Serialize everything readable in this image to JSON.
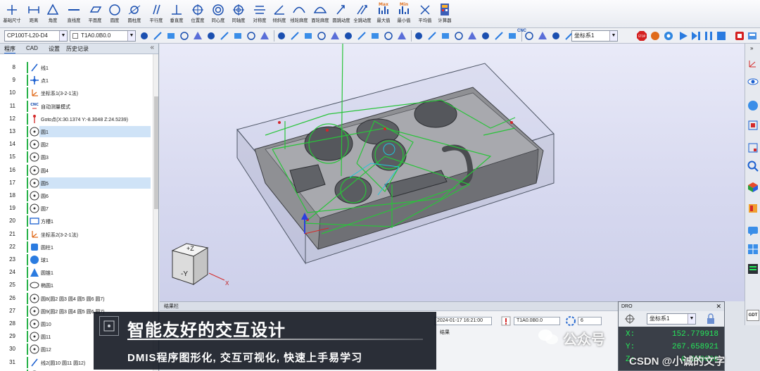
{
  "ribbon": {
    "buttons": [
      {
        "label": "基础尺寸",
        "icon": "basic-dimension-icon"
      },
      {
        "label": "距离",
        "icon": "distance-icon"
      },
      {
        "label": "角度",
        "icon": "angle-icon"
      },
      {
        "label": "直线度",
        "icon": "straightness-icon"
      },
      {
        "label": "平面度",
        "icon": "flatness-icon"
      },
      {
        "label": "圆度",
        "icon": "roundness-icon"
      },
      {
        "label": "圆柱度",
        "icon": "cylindricity-icon"
      },
      {
        "label": "平行度",
        "icon": "parallelism-icon"
      },
      {
        "label": "垂直度",
        "icon": "perpendicularity-icon"
      },
      {
        "label": "位置度",
        "icon": "position-icon"
      },
      {
        "label": "同心度",
        "icon": "concentricity-icon"
      },
      {
        "label": "同轴度",
        "icon": "coaxiality-icon"
      },
      {
        "label": "对称度",
        "icon": "symmetry-icon"
      },
      {
        "label": "倾斜度",
        "icon": "angularity-icon"
      },
      {
        "label": "线轮廓度",
        "icon": "line-profile-icon"
      },
      {
        "label": "面轮廓度",
        "icon": "surface-profile-icon"
      },
      {
        "label": "圆跳动度",
        "icon": "circular-runout-icon"
      },
      {
        "label": "全跳动度",
        "icon": "total-runout-icon"
      },
      {
        "label": "最大值",
        "icon": "max-icon",
        "badge": "Max"
      },
      {
        "label": "最小值",
        "icon": "min-icon",
        "badge": "Min"
      },
      {
        "label": "平均值",
        "icon": "average-icon"
      },
      {
        "label": "计算器",
        "icon": "calculator-icon"
      }
    ]
  },
  "toolbar": {
    "probe_combo": "CP100T-L20-D4",
    "tip_combo": "T1A0.0B0.0",
    "cnc_label": "CNC",
    "coord_combo": "坐标系1"
  },
  "left_panel": {
    "tabs": [
      "程序",
      "CAD",
      "设置",
      "历史记录"
    ],
    "collapse_glyph": "«",
    "rows": [
      {
        "num": "8",
        "text": "线1",
        "icon": "line-icon"
      },
      {
        "num": "9",
        "text": "点1",
        "icon": "point-icon"
      },
      {
        "num": "10",
        "text": "坐标系1(3-2-1法)",
        "icon": "coordinate-system-icon"
      },
      {
        "num": "11",
        "text": "自动测量模式",
        "icon": "cnc-icon"
      },
      {
        "num": "12",
        "text": "Goto点(X:30.1374 Y:-8.3048 Z:24.5239)",
        "icon": "goto-icon"
      },
      {
        "num": "13",
        "text": "圆1",
        "icon": "circle-icon",
        "selected": true
      },
      {
        "num": "14",
        "text": "圆2",
        "icon": "circle-icon"
      },
      {
        "num": "15",
        "text": "圆3",
        "icon": "circle-icon"
      },
      {
        "num": "16",
        "text": "圆4",
        "icon": "circle-icon"
      },
      {
        "num": "17",
        "text": "圆5",
        "icon": "circle-icon",
        "selected": true
      },
      {
        "num": "18",
        "text": "圆6",
        "icon": "circle-icon"
      },
      {
        "num": "19",
        "text": "圆7",
        "icon": "circle-icon"
      },
      {
        "num": "20",
        "text": "方槽1",
        "icon": "square-slot-icon"
      },
      {
        "num": "21",
        "text": "坐标系2(3-2-1法)",
        "icon": "coordinate-system-icon"
      },
      {
        "num": "22",
        "text": "圆柱1",
        "icon": "cylinder-icon"
      },
      {
        "num": "23",
        "text": "球1",
        "icon": "sphere-icon"
      },
      {
        "num": "24",
        "text": "圆锥1",
        "icon": "cone-icon"
      },
      {
        "num": "25",
        "text": "椭圆1",
        "icon": "ellipse-icon"
      },
      {
        "num": "26",
        "text": "圆8(圆2 圆3 圆4 圆5 圆6 圆7)",
        "icon": "circle-icon"
      },
      {
        "num": "27",
        "text": "圆9(圆2 圆3 圆4 圆5 圆6 圆7)",
        "icon": "circle-icon"
      },
      {
        "num": "28",
        "text": "圆10",
        "icon": "circle-icon"
      },
      {
        "num": "29",
        "text": "圆11",
        "icon": "circle-icon"
      },
      {
        "num": "30",
        "text": "圆12",
        "icon": "circle-icon"
      },
      {
        "num": "31",
        "text": "线2(圆10 圆11 圆12)",
        "icon": "line-icon"
      },
      {
        "num": "32",
        "text": "",
        "icon": "circle-icon"
      }
    ]
  },
  "viewport": {
    "view_cube": {
      "top": "+Z",
      "front": "-Y"
    },
    "axis_x": "X"
  },
  "results": {
    "title": "结果栏",
    "date": "2024-01-17 16:21:00",
    "tip": "T1A0.0B0.0",
    "count": "6",
    "result_label": "结果"
  },
  "dro": {
    "title": "DRO",
    "coord": "坐标系1",
    "x_label": "X:",
    "x_value": "152.779918",
    "y_label": "Y:",
    "y_value": "267.658921",
    "z_label": "Z:",
    "z_value": "0.000000"
  },
  "right_extra": {
    "gdt": "GDT"
  },
  "caption": {
    "title": "智能友好的交互设计",
    "subtitle": "DMIS程序图形化, 交互可视化, 快速上手易学习"
  },
  "watermarks": {
    "wechat": "公众号",
    "csdn": "CSDN @小诚的文字"
  },
  "colors": {
    "feature_green": "#29c43a",
    "selection_blue": "#cfe3f7",
    "dro_green": "#25e85a"
  }
}
